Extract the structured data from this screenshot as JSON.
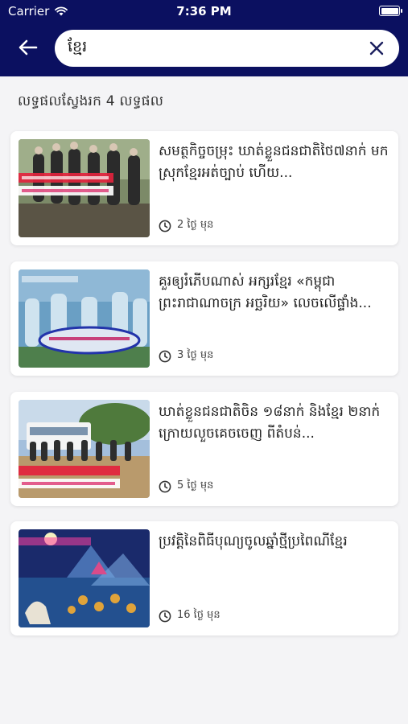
{
  "status_bar": {
    "carrier": "Carrier",
    "time": "7:36 PM"
  },
  "search": {
    "query": "ខ្មែរ"
  },
  "results_count": "លទ្ធផលស្វែងរក 4 លទ្ធផល",
  "results": [
    {
      "title": "សមត្ថកិច្ចចម្រុះ ឃាត់ខ្លួនជនជាតិថៃ៧នាក់ មកស្រុកខ្មែរអត់ច្បាប់ ហើយ...",
      "time": "2 ថ្ងៃ មុន"
    },
    {
      "title": "គួរឲ្យរំភើបណាស់ អក្សរខ្មែរ «កម្ពុជា ព្រះរាជាណាចក្រ អច្ឆរិយ» លេចលើផ្ទាំង...",
      "time": "3 ថ្ងៃ មុន"
    },
    {
      "title": "ឃាត់ខ្លួនជនជាតិចិន ១៨នាក់ និងខ្មែរ ២នាក់ ក្រោយលួចគេចចេញ ពីតំបន់...",
      "time": "5 ថ្ងៃ មុន"
    },
    {
      "title": "ប្រវត្តិនៃពិធីបុណ្យចូលឆ្នាំថ្មីប្រពៃណីខ្មែរ",
      "time": "16 ថ្ងៃ មុន"
    }
  ],
  "colors": {
    "header_bg": "#0b1060",
    "page_bg": "#f4f4f6"
  }
}
